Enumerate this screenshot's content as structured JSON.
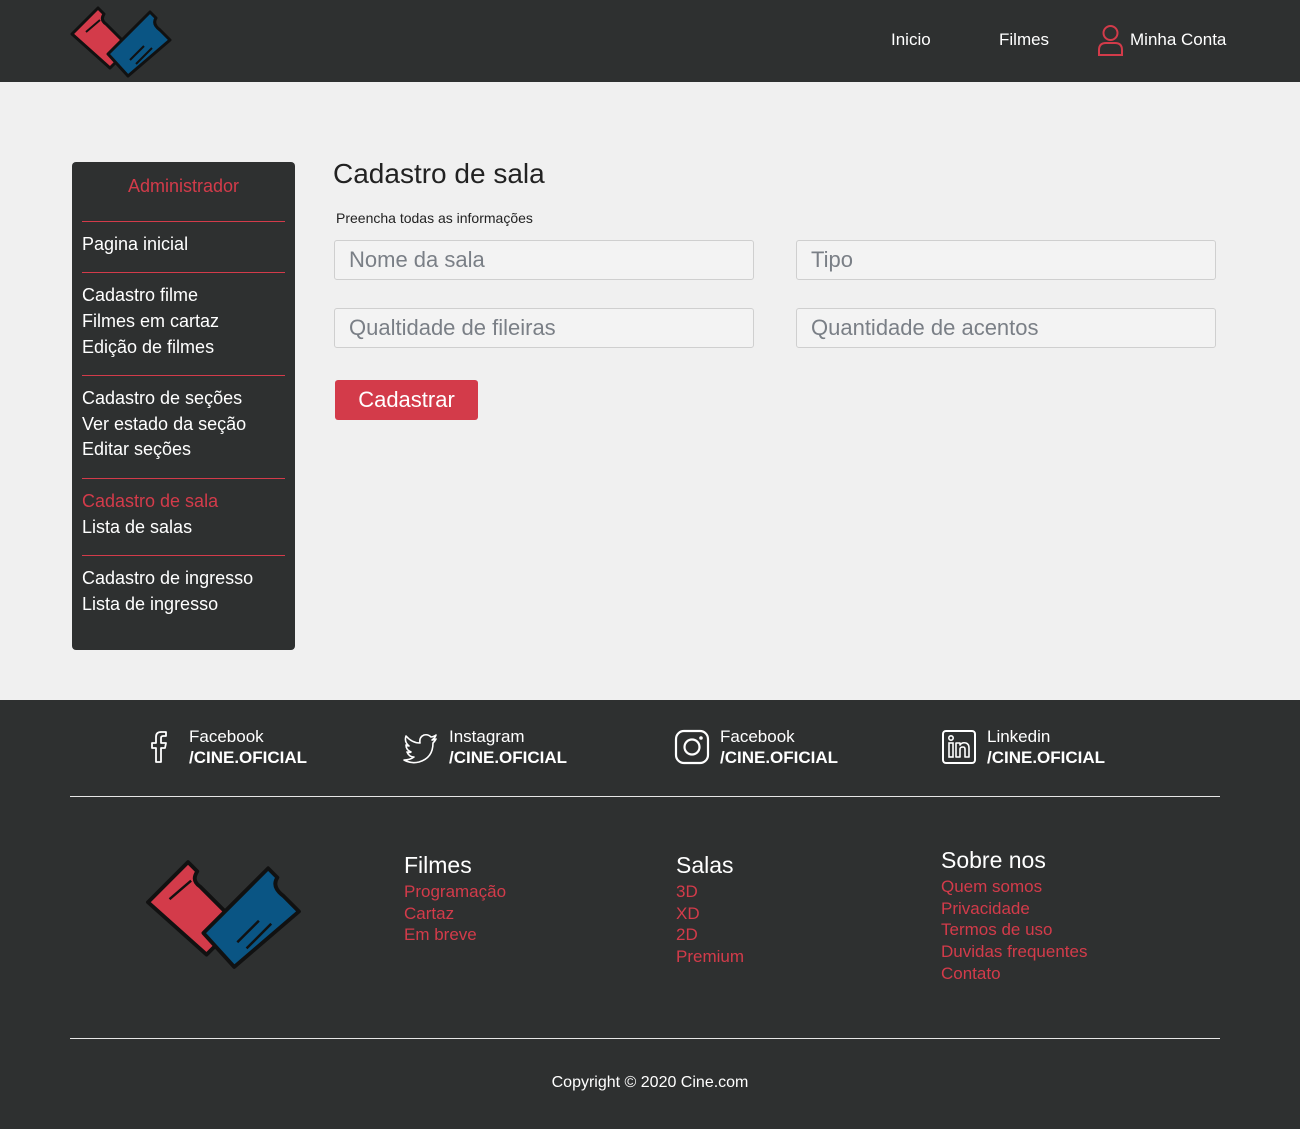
{
  "header": {
    "nav": {
      "home": "Inicio",
      "films": "Filmes",
      "account": "Minha Conta"
    }
  },
  "sidebar": {
    "title": "Administrador",
    "items": [
      "Pagina inicial",
      "Cadastro filme",
      "Filmes em cartaz",
      "Edição de filmes",
      "Cadastro de seções",
      "Ver estado da seção",
      "Editar seções",
      "Cadastro de sala",
      "Lista de salas",
      "Cadastro de ingresso",
      "Lista de ingresso"
    ],
    "active": "Cadastro de sala"
  },
  "main": {
    "title": "Cadastro de sala",
    "subtitle": "Preencha todas as informações",
    "fields": {
      "name_placeholder": "Nome da sala",
      "type_placeholder": "Tipo",
      "rows_placeholder": "Qualtidade de fileiras",
      "seats_placeholder": "Quantidade de acentos"
    },
    "submit_label": "Cadastrar"
  },
  "footer": {
    "social": [
      {
        "name": "Facebook",
        "handle": "/CINE.OFICIAL",
        "icon": "facebook-icon"
      },
      {
        "name": "Instagram",
        "handle": "/CINE.OFICIAL",
        "icon": "twitter-icon"
      },
      {
        "name": "Facebook",
        "handle": "/CINE.OFICIAL",
        "icon": "instagram-icon"
      },
      {
        "name": "Linkedin",
        "handle": "/CINE.OFICIAL",
        "icon": "linkedin-icon"
      }
    ],
    "columns": [
      {
        "title": "Filmes",
        "links": [
          "Programação",
          "Cartaz",
          "Em breve"
        ]
      },
      {
        "title": "Salas",
        "links": [
          "3D",
          "XD",
          "2D",
          "Premium"
        ]
      },
      {
        "title": "Sobre nos",
        "links": [
          "Quem somos",
          "Privacidade",
          "Termos de uso",
          "Duvidas frequentes",
          "Contato"
        ]
      }
    ],
    "copyright": "Copyright © 2020 Cine.com"
  },
  "colors": {
    "dark": "#2e3030",
    "accent": "#d33b4a",
    "ticket_blue": "#0a5584",
    "background": "#f0f0f0"
  }
}
